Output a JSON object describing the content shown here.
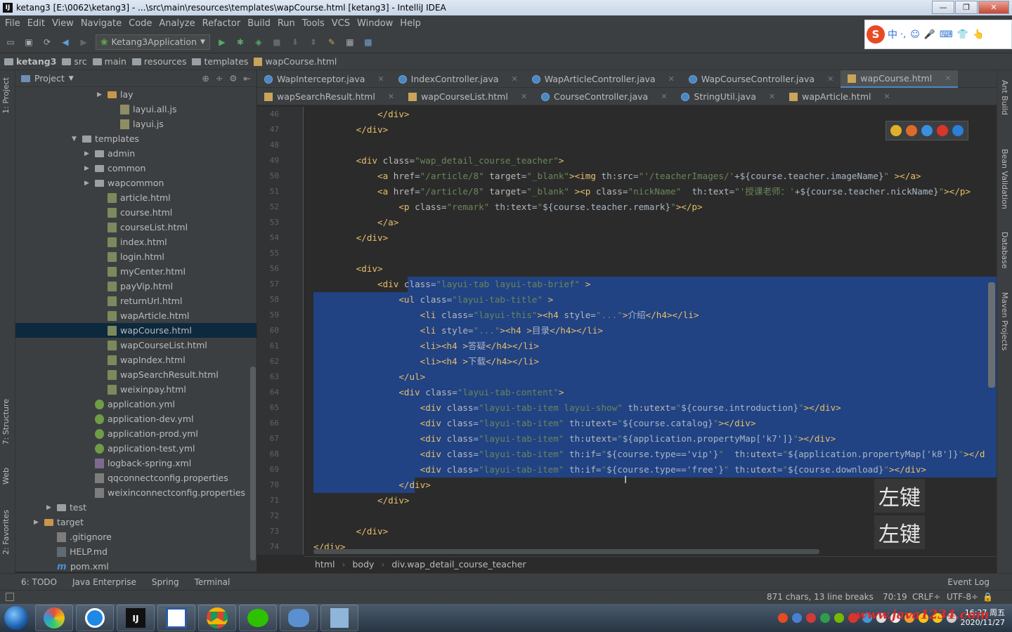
{
  "window": {
    "title": "ketang3 [E:\\0062\\ketang3] - ...\\src\\main\\resources\\templates\\wapCourse.html [ketang3] - IntelliJ IDEA",
    "minimize": "—",
    "maximize": "❐",
    "close": "✕"
  },
  "menu": [
    "File",
    "Edit",
    "View",
    "Navigate",
    "Code",
    "Analyze",
    "Refactor",
    "Build",
    "Run",
    "Tools",
    "VCS",
    "Window",
    "Help"
  ],
  "toolbar": {
    "run_config": "Ketang3Application"
  },
  "ime": {
    "label": "中",
    "icons": [
      "·,",
      "☺",
      "🎤",
      "⌨",
      "👕",
      "👆"
    ]
  },
  "breadcrumb": [
    "ketang3",
    "src",
    "main",
    "resources",
    "templates",
    "wapCourse.html"
  ],
  "project": {
    "title": "Project",
    "tree": [
      {
        "label": "lay",
        "indent": 6,
        "type": "folder-o",
        "arrow": "▶"
      },
      {
        "label": "layui.all.js",
        "indent": 7,
        "type": "js"
      },
      {
        "label": "layui.js",
        "indent": 7,
        "type": "js"
      },
      {
        "label": "templates",
        "indent": 4,
        "type": "folder",
        "arrow": "▼"
      },
      {
        "label": "admin",
        "indent": 5,
        "type": "folder",
        "arrow": "▶"
      },
      {
        "label": "common",
        "indent": 5,
        "type": "folder",
        "arrow": "▶"
      },
      {
        "label": "wapcommon",
        "indent": 5,
        "type": "folder",
        "arrow": "▶"
      },
      {
        "label": "article.html",
        "indent": 6,
        "type": "html"
      },
      {
        "label": "course.html",
        "indent": 6,
        "type": "html"
      },
      {
        "label": "courseList.html",
        "indent": 6,
        "type": "html"
      },
      {
        "label": "index.html",
        "indent": 6,
        "type": "html"
      },
      {
        "label": "login.html",
        "indent": 6,
        "type": "html"
      },
      {
        "label": "myCenter.html",
        "indent": 6,
        "type": "html"
      },
      {
        "label": "payVip.html",
        "indent": 6,
        "type": "html"
      },
      {
        "label": "returnUrl.html",
        "indent": 6,
        "type": "html"
      },
      {
        "label": "wapArticle.html",
        "indent": 6,
        "type": "html"
      },
      {
        "label": "wapCourse.html",
        "indent": 6,
        "type": "html",
        "selected": true
      },
      {
        "label": "wapCourseList.html",
        "indent": 6,
        "type": "html"
      },
      {
        "label": "wapIndex.html",
        "indent": 6,
        "type": "html"
      },
      {
        "label": "wapSearchResult.html",
        "indent": 6,
        "type": "html"
      },
      {
        "label": "weixinpay.html",
        "indent": 6,
        "type": "html"
      },
      {
        "label": "application.yml",
        "indent": 5,
        "type": "yml"
      },
      {
        "label": "application-dev.yml",
        "indent": 5,
        "type": "yml"
      },
      {
        "label": "application-prod.yml",
        "indent": 5,
        "type": "yml"
      },
      {
        "label": "application-test.yml",
        "indent": 5,
        "type": "yml"
      },
      {
        "label": "logback-spring.xml",
        "indent": 5,
        "type": "xml"
      },
      {
        "label": "qqconnectconfig.properties",
        "indent": 5,
        "type": "prop"
      },
      {
        "label": "weixinconnectconfig.properties",
        "indent": 5,
        "type": "prop"
      },
      {
        "label": "test",
        "indent": 2,
        "type": "folder",
        "arrow": "▶"
      },
      {
        "label": "target",
        "indent": 1,
        "type": "folder-o",
        "arrow": "▶"
      },
      {
        "label": ".gitignore",
        "indent": 2,
        "type": "prop"
      },
      {
        "label": "HELP.md",
        "indent": 2,
        "type": "md"
      },
      {
        "label": "pom.xml",
        "indent": 2,
        "type": "mvn"
      }
    ]
  },
  "left_tool_tabs": [
    "1: Project",
    "7: Structure",
    "Web",
    "2: Favorites"
  ],
  "right_tool_tabs": [
    "Ant Build",
    "Bean Validation",
    "Database",
    "Maven Projects"
  ],
  "tabs_row1": [
    {
      "label": "WapInterceptor.java",
      "kind": "java"
    },
    {
      "label": "IndexController.java",
      "kind": "java"
    },
    {
      "label": "WapArticleController.java",
      "kind": "java"
    },
    {
      "label": "WapCourseController.java",
      "kind": "java"
    },
    {
      "label": "wapCourse.html",
      "kind": "html",
      "active": true
    }
  ],
  "tabs_row2": [
    {
      "label": "wapSearchResult.html",
      "kind": "html"
    },
    {
      "label": "wapCourseList.html",
      "kind": "html"
    },
    {
      "label": "CourseController.java",
      "kind": "java"
    },
    {
      "label": "StringUtil.java",
      "kind": "java"
    },
    {
      "label": "wapArticle.html",
      "kind": "html"
    }
  ],
  "line_numbers": [
    "46",
    "47",
    "48",
    "49",
    "50",
    "51",
    "52",
    "53",
    "54",
    "55",
    "56",
    "57",
    "58",
    "59",
    "60",
    "61",
    "62",
    "63",
    "64",
    "65",
    "66",
    "67",
    "68",
    "69",
    "70",
    "71",
    "72",
    "73",
    "74"
  ],
  "code": [
    [
      [
        "t",
        "            </div>"
      ]
    ],
    [
      [
        "t",
        "        </div>"
      ]
    ],
    [],
    [
      [
        "t",
        "        <div "
      ],
      [
        "a",
        "class"
      ],
      [
        "x",
        "="
      ],
      [
        "s",
        "\"wap_detail_course_teacher\""
      ],
      [
        "t",
        ">"
      ]
    ],
    [
      [
        "t",
        "            <a "
      ],
      [
        "a",
        "href"
      ],
      [
        "x",
        "="
      ],
      [
        "s",
        "\"/article/8\" "
      ],
      [
        "a",
        "target"
      ],
      [
        "x",
        "="
      ],
      [
        "s",
        "\"_blank\""
      ],
      [
        "t",
        "><img "
      ],
      [
        "p",
        "th"
      ],
      [
        "a",
        ":src"
      ],
      [
        "x",
        "="
      ],
      [
        "s",
        "\"'/teacherImages/'"
      ],
      [
        "x",
        "+${course.teacher.imageName}"
      ],
      [
        "s",
        "\""
      ],
      [
        "t",
        " ></a>"
      ]
    ],
    [
      [
        "t",
        "            <a "
      ],
      [
        "a",
        "href"
      ],
      [
        "x",
        "="
      ],
      [
        "s",
        "\"/article/8\" "
      ],
      [
        "a",
        "target"
      ],
      [
        "x",
        "="
      ],
      [
        "s",
        "\"_blank\" "
      ],
      [
        "t",
        "><p "
      ],
      [
        "a",
        "class"
      ],
      [
        "x",
        "="
      ],
      [
        "s",
        "\"nickName\"  "
      ],
      [
        "p",
        "th"
      ],
      [
        "a",
        ":text"
      ],
      [
        "x",
        "="
      ],
      [
        "s",
        "\"'授课老师：'"
      ],
      [
        "x",
        "+${course.teacher.nickName}"
      ],
      [
        "s",
        "\""
      ],
      [
        "t",
        "></p>"
      ]
    ],
    [
      [
        "t",
        "                <p "
      ],
      [
        "a",
        "class"
      ],
      [
        "x",
        "="
      ],
      [
        "s",
        "\"remark\" "
      ],
      [
        "p",
        "th"
      ],
      [
        "a",
        ":text"
      ],
      [
        "x",
        "="
      ],
      [
        "s",
        "\""
      ],
      [
        "x",
        "${course.teacher.remark}"
      ],
      [
        "s",
        "\""
      ],
      [
        "t",
        "></p>"
      ]
    ],
    [
      [
        "t",
        "            </a>"
      ]
    ],
    [
      [
        "t",
        "        </div>"
      ]
    ],
    [],
    [
      [
        "t",
        "        <div>"
      ]
    ],
    [
      [
        "t",
        "            <div "
      ],
      [
        "a",
        "class"
      ],
      [
        "x",
        "="
      ],
      [
        "s",
        "\"layui-tab layui-tab-brief\""
      ],
      [
        "t",
        " >"
      ]
    ],
    [
      [
        "t",
        "                <ul "
      ],
      [
        "a",
        "class"
      ],
      [
        "x",
        "="
      ],
      [
        "s",
        "\"layui-tab-title\""
      ],
      [
        "t",
        " >"
      ]
    ],
    [
      [
        "t",
        "                    <li "
      ],
      [
        "a",
        "class"
      ],
      [
        "x",
        "="
      ],
      [
        "s",
        "\"layui-this\""
      ],
      [
        "t",
        "><h4 "
      ],
      [
        "a",
        "style"
      ],
      [
        "x",
        "="
      ],
      [
        "s",
        "\"...\""
      ],
      [
        "t",
        ">"
      ],
      [
        "x",
        "介绍"
      ],
      [
        "t",
        "</h4></li>"
      ]
    ],
    [
      [
        "t",
        "                    <li "
      ],
      [
        "a",
        "style"
      ],
      [
        "x",
        "="
      ],
      [
        "s",
        "\"...\""
      ],
      [
        "t",
        "><h4 >"
      ],
      [
        "x",
        "目录"
      ],
      [
        "t",
        "</h4></li>"
      ]
    ],
    [
      [
        "t",
        "                    <li><h4 >"
      ],
      [
        "x",
        "答疑"
      ],
      [
        "t",
        "</h4></li>"
      ]
    ],
    [
      [
        "t",
        "                    <li><h4 >"
      ],
      [
        "x",
        "下载"
      ],
      [
        "t",
        "</h4></li>"
      ]
    ],
    [
      [
        "t",
        "                </ul>"
      ]
    ],
    [
      [
        "t",
        "                <div "
      ],
      [
        "a",
        "class"
      ],
      [
        "x",
        "="
      ],
      [
        "s",
        "\"layui-tab-content\""
      ],
      [
        "t",
        ">"
      ]
    ],
    [
      [
        "t",
        "                    <div "
      ],
      [
        "a",
        "class"
      ],
      [
        "x",
        "="
      ],
      [
        "s",
        "\"layui-tab-item layui-show\" "
      ],
      [
        "p",
        "th"
      ],
      [
        "a",
        ":utext"
      ],
      [
        "x",
        "="
      ],
      [
        "s",
        "\""
      ],
      [
        "x",
        "${course.introduction}"
      ],
      [
        "s",
        "\""
      ],
      [
        "t",
        "></div>"
      ]
    ],
    [
      [
        "t",
        "                    <div "
      ],
      [
        "a",
        "class"
      ],
      [
        "x",
        "="
      ],
      [
        "s",
        "\"layui-tab-item\" "
      ],
      [
        "p",
        "th"
      ],
      [
        "a",
        ":utext"
      ],
      [
        "x",
        "="
      ],
      [
        "s",
        "\""
      ],
      [
        "x",
        "${course.catalog}"
      ],
      [
        "s",
        "\""
      ],
      [
        "t",
        "></div>"
      ]
    ],
    [
      [
        "t",
        "                    <div "
      ],
      [
        "a",
        "class"
      ],
      [
        "x",
        "="
      ],
      [
        "s",
        "\"layui-tab-item\" "
      ],
      [
        "p",
        "th"
      ],
      [
        "a",
        ":utext"
      ],
      [
        "x",
        "="
      ],
      [
        "s",
        "\""
      ],
      [
        "x",
        "${application.propertyMap['k7']}"
      ],
      [
        "s",
        "\""
      ],
      [
        "t",
        "></div>"
      ]
    ],
    [
      [
        "t",
        "                    <div "
      ],
      [
        "a",
        "class"
      ],
      [
        "x",
        "="
      ],
      [
        "s",
        "\"layui-tab-item\" "
      ],
      [
        "p",
        "th"
      ],
      [
        "a",
        ":if"
      ],
      [
        "x",
        "="
      ],
      [
        "s",
        "\""
      ],
      [
        "x",
        "${course.type=='vip'}"
      ],
      [
        "s",
        "\"  "
      ],
      [
        "p",
        "th"
      ],
      [
        "a",
        ":utext"
      ],
      [
        "x",
        "="
      ],
      [
        "s",
        "\""
      ],
      [
        "x",
        "${application.propertyMap['k8']}"
      ],
      [
        "s",
        "\""
      ],
      [
        "t",
        "></d"
      ]
    ],
    [
      [
        "t",
        "                    <div "
      ],
      [
        "a",
        "class"
      ],
      [
        "x",
        "="
      ],
      [
        "s",
        "\"layui-tab-item\" "
      ],
      [
        "p",
        "th"
      ],
      [
        "a",
        ":if"
      ],
      [
        "x",
        "="
      ],
      [
        "s",
        "\""
      ],
      [
        "x",
        "${course.type=='free'}"
      ],
      [
        "s",
        "\" "
      ],
      [
        "p",
        "th"
      ],
      [
        "a",
        ":utext"
      ],
      [
        "x",
        "="
      ],
      [
        "s",
        "\""
      ],
      [
        "x",
        "${course.download}"
      ],
      [
        "s",
        "\""
      ],
      [
        "t",
        "></div>"
      ]
    ],
    [
      [
        "t",
        "                </div>"
      ]
    ],
    [
      [
        "t",
        "            </div>"
      ]
    ],
    [],
    [
      [
        "t",
        "        </div>"
      ]
    ],
    [
      [
        "t",
        "</div>"
      ]
    ]
  ],
  "overlay": [
    "左键",
    "左键"
  ],
  "editor_breadcrumb": [
    "html",
    "body",
    "div.wap_detail_course_teacher"
  ],
  "tool_windows": [
    "6: TODO",
    "Java Enterprise",
    "Spring",
    "Terminal"
  ],
  "event_log": "Event Log",
  "status": {
    "chars": "871 chars, 13 line breaks",
    "position": "70:19",
    "line_sep": "CRLF÷",
    "encoding": "UTF-8÷"
  },
  "taskbar": {
    "time": "16:27 周五",
    "date": "2020/11/27"
  },
  "watermark": "www.java1234.com"
}
